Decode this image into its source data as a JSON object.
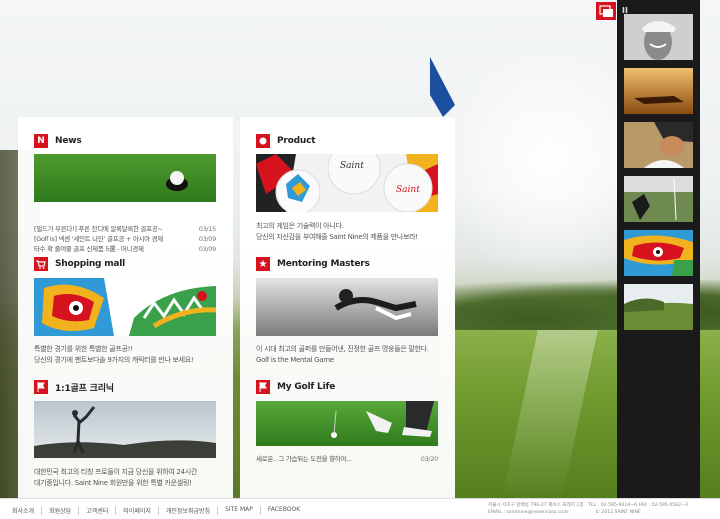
{
  "news": {
    "title": "News",
    "icon": "N",
    "items": [
      {
        "text": "[필드가 부른다!] 푸른 잔디에 알록달록한 골프공~",
        "date": "03/15"
      },
      {
        "text": "[Golf is] 넥센 ‘세인트 나인’ 골프공 + 아시아 경제",
        "date": "03/09"
      },
      {
        "text": "타수 확 줄여줄 골프 신제품 5選 - 머니경제",
        "date": "03/09"
      }
    ]
  },
  "product": {
    "title": "Product",
    "lines": [
      "최고의 게임은 기술력이 아니다.",
      "당신의 자신감을 부여해줄 Saint Nine의 제품을 만나보라!"
    ]
  },
  "shopping": {
    "title": "Shopping mall",
    "lines": [
      "특별한 경기를 위한 특별한 골프공!!",
      "당신의 경기에 팬트보다솔 9가지의 캐릭터를 만나 보세요!"
    ]
  },
  "mentoring": {
    "title": "Mentoring Masters",
    "lines": [
      "이 시대 최고의 골퍼를 만들어낸, 진정한 골프 명웅들은 말한다.",
      "Golf is the Mental Game"
    ]
  },
  "lesson": {
    "title": "1:1골프 크리닉",
    "lines": [
      "대한민국 최고의 티칭 프로들이 지금 당신을 위하여 24시간",
      "대기중입니다. Saint Nine 회원만을 위한 특별 카운셀링!"
    ]
  },
  "mygolf": {
    "title": "My Golf Life",
    "items": [
      {
        "text": "세로운.. 그 가슴뛰는 도전을 향하여...",
        "date": "03/20"
      }
    ]
  },
  "footer": {
    "nav": [
      "회사소개",
      "회원상담",
      "고객센터",
      "마이페이지",
      "개인정보취급방침",
      "SITE MAP",
      "FACEBOOK"
    ],
    "address": "서울시 서초구 방배동 796-27 제이스 프레지 1층",
    "email": "EMAIL : saintnine@nexencorp.co.kr",
    "tel": "TEL : 02-595-9414~6   FAX : 02-595-0582~3",
    "copyright": "© 2012 SAINT NINE"
  },
  "strip": {
    "pause_label": "II"
  },
  "colors": {
    "accent": "#d6121f",
    "strip": "#1a1a1a"
  }
}
